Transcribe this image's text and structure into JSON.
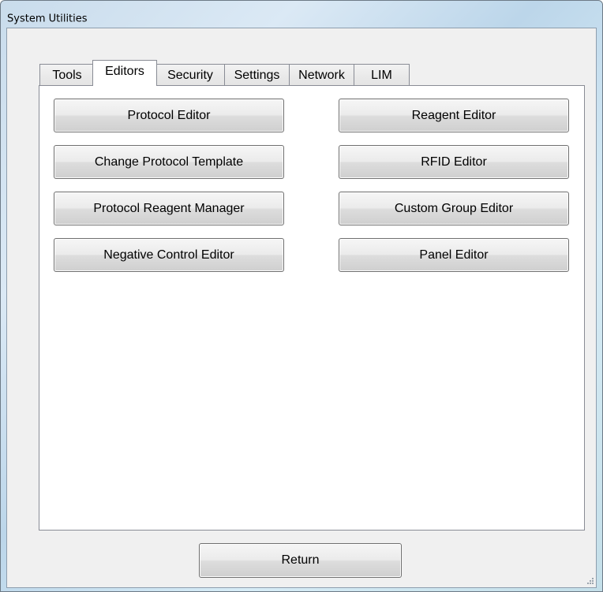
{
  "window": {
    "title": "System Utilities"
  },
  "tabs": [
    {
      "label": "Tools"
    },
    {
      "label": "Editors"
    },
    {
      "label": "Security"
    },
    {
      "label": "Settings"
    },
    {
      "label": "Network"
    },
    {
      "label": "LIM"
    }
  ],
  "active_tab": "Editors",
  "editors": {
    "left": [
      {
        "label": "Protocol Editor"
      },
      {
        "label": "Change Protocol Template"
      },
      {
        "label": "Protocol Reagent Manager"
      },
      {
        "label": "Negative Control Editor"
      }
    ],
    "right": [
      {
        "label": "Reagent Editor"
      },
      {
        "label": "RFID Editor"
      },
      {
        "label": "Custom Group Editor"
      },
      {
        "label": "Panel Editor"
      }
    ]
  },
  "footer": {
    "return_label": "Return"
  },
  "colors": {
    "tab_border": "#898c95",
    "button_border": "#707070",
    "client_bg": "#f0f0f0"
  }
}
